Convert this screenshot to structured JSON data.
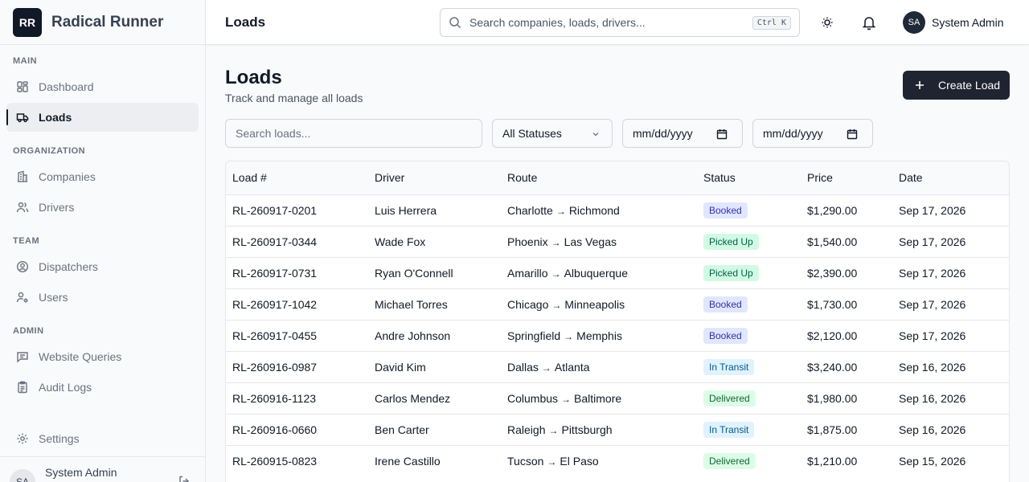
{
  "brand": {
    "logo": "RR",
    "name": "Radical Runner"
  },
  "sidebar": {
    "sections": {
      "main": "MAIN",
      "organization": "ORGANIZATION",
      "team": "TEAM",
      "admin": "ADMIN"
    },
    "items": {
      "dashboard": "Dashboard",
      "loads": "Loads",
      "companies": "Companies",
      "drivers": "Drivers",
      "dispatchers": "Dispatchers",
      "users": "Users",
      "website_queries": "Website Queries",
      "audit_logs": "Audit Logs",
      "settings": "Settings"
    },
    "footer": {
      "avatar": "SA",
      "name": "System Admin"
    }
  },
  "topbar": {
    "title": "Loads",
    "search_placeholder": "Search companies, loads, drivers...",
    "shortcut": "Ctrl K",
    "user": {
      "avatar": "SA",
      "name": "System Admin"
    }
  },
  "page": {
    "title": "Loads",
    "subtitle": "Track and manage all loads",
    "create_label": "Create Load",
    "filters": {
      "search_placeholder": "Search loads...",
      "status": "All Statuses",
      "date_from": "mm/dd/yyyy",
      "date_to": "mm/dd/yyyy"
    }
  },
  "table": {
    "columns": {
      "load": "Load #",
      "driver": "Driver",
      "route": "Route",
      "status": "Status",
      "price": "Price",
      "date": "Date"
    },
    "route_arrow": "→",
    "rows": [
      {
        "id": "RL-260917-0201",
        "driver": "Luis Herrera",
        "from": "Charlotte",
        "to": "Richmond",
        "status": "Booked",
        "price": "$1,290.00",
        "date": "Sep 17, 2026"
      },
      {
        "id": "RL-260917-0344",
        "driver": "Wade Fox",
        "from": "Phoenix",
        "to": "Las Vegas",
        "status": "Picked Up",
        "price": "$1,540.00",
        "date": "Sep 17, 2026"
      },
      {
        "id": "RL-260917-0731",
        "driver": "Ryan O'Connell",
        "from": "Amarillo",
        "to": "Albuquerque",
        "status": "Picked Up",
        "price": "$2,390.00",
        "date": "Sep 17, 2026"
      },
      {
        "id": "RL-260917-1042",
        "driver": "Michael Torres",
        "from": "Chicago",
        "to": "Minneapolis",
        "status": "Booked",
        "price": "$1,730.00",
        "date": "Sep 17, 2026"
      },
      {
        "id": "RL-260917-0455",
        "driver": "Andre Johnson",
        "from": "Springfield",
        "to": "Memphis",
        "status": "Booked",
        "price": "$2,120.00",
        "date": "Sep 17, 2026"
      },
      {
        "id": "RL-260916-0987",
        "driver": "David Kim",
        "from": "Dallas",
        "to": "Atlanta",
        "status": "In Transit",
        "price": "$3,240.00",
        "date": "Sep 16, 2026"
      },
      {
        "id": "RL-260916-1123",
        "driver": "Carlos Mendez",
        "from": "Columbus",
        "to": "Baltimore",
        "status": "Delivered",
        "price": "$1,980.00",
        "date": "Sep 16, 2026"
      },
      {
        "id": "RL-260916-0660",
        "driver": "Ben Carter",
        "from": "Raleigh",
        "to": "Pittsburgh",
        "status": "In Transit",
        "price": "$1,875.00",
        "date": "Sep 16, 2026"
      },
      {
        "id": "RL-260915-0823",
        "driver": "Irene Castillo",
        "from": "Tucson",
        "to": "El Paso",
        "status": "Delivered",
        "price": "$1,210.00",
        "date": "Sep 15, 2026"
      }
    ]
  },
  "status_colors": {
    "Booked": {
      "bg": "#e0e7ff",
      "fg": "#3730a3"
    },
    "Picked Up": {
      "bg": "#d1fae5",
      "fg": "#065f46"
    },
    "In Transit": {
      "bg": "#e0f2fe",
      "fg": "#075985"
    },
    "Delivered": {
      "bg": "#dcfce7",
      "fg": "#166534"
    }
  },
  "icons": {
    "dashboard": "layout-grid-icon",
    "loads": "truck-icon",
    "companies": "building-icon",
    "drivers": "users-icon",
    "dispatchers": "user-circle-icon",
    "users": "user-cog-icon",
    "website_queries": "message-square-icon",
    "audit_logs": "clipboard-icon",
    "settings": "gear-icon",
    "theme": "sun-icon",
    "notifications": "bell-icon"
  }
}
